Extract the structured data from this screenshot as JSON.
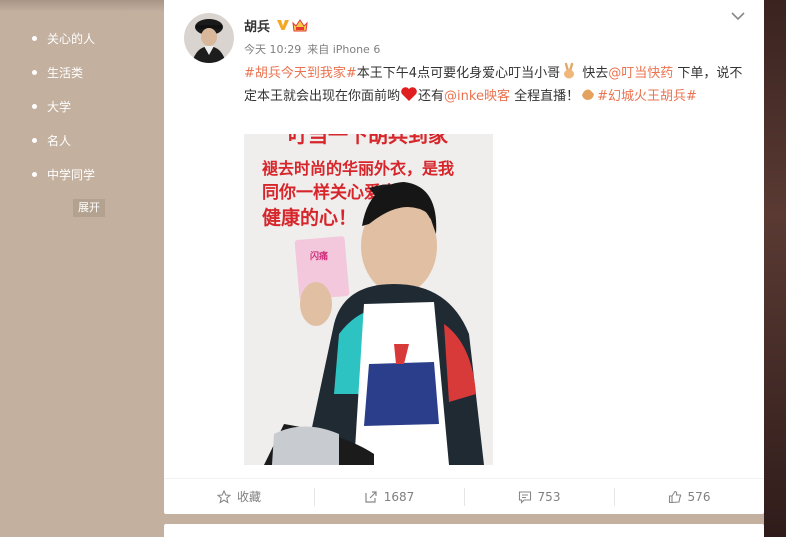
{
  "sidebar": {
    "items": [
      {
        "label": "关心的人"
      },
      {
        "label": "生活类"
      },
      {
        "label": "大学"
      },
      {
        "label": "名人"
      },
      {
        "label": "中学同学"
      }
    ],
    "expand_label": "展开"
  },
  "post": {
    "username": "胡兵",
    "verified_icon": "verified-v-icon",
    "badge_icon": "crown-badge-icon",
    "time": "今天 10:29",
    "source": "来自 iPhone 6",
    "text": {
      "hashtag1": "#胡兵今天到我家#",
      "seg1": "本王下午4点可要化身爱心叮当小哥",
      "seg2": " 快去",
      "mention1": "@叮当快药",
      "seg3": " 下单，说不定本王就会出现在你面前哟",
      "seg4": "还有",
      "mention2": "@inke映客",
      "seg5": " 全程直播！",
      "hashtag2": "#幻城火王胡兵#"
    },
    "poster": {
      "headline_top": "叮当一下胡兵到家",
      "line1": "褪去时尚的华丽外衣，是我",
      "line2": "同你一样关心爱家人",
      "line3": "健康的心！",
      "product": "闪痛"
    }
  },
  "actions": {
    "favorite": {
      "label": "收藏",
      "icon": "star-icon"
    },
    "repost": {
      "label": "1687",
      "icon": "repost-icon"
    },
    "comment": {
      "label": "753",
      "icon": "comment-icon"
    },
    "like": {
      "label": "576",
      "icon": "thumbs-up-icon"
    }
  },
  "colors": {
    "link": "#eb7350",
    "sidebar_bg": "#c3b09f"
  }
}
